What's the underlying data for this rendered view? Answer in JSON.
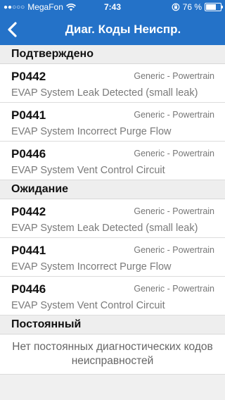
{
  "status_bar": {
    "signal_dots": "●●○○○",
    "carrier": "MegaFon",
    "wifi_icon": "wifi-icon",
    "time": "7:43",
    "battery_percent_text": "76 %",
    "battery_level": 0.76
  },
  "nav": {
    "back_icon": "chevron-left-icon",
    "title": "Диаг. Коды Неиспр."
  },
  "sections": [
    {
      "title": "Подтверждено",
      "items": [
        {
          "code": "P0442",
          "category": "Generic - Powertrain",
          "description": "EVAP System Leak Detected (small leak)"
        },
        {
          "code": "P0441",
          "category": "Generic - Powertrain",
          "description": "EVAP System Incorrect Purge Flow"
        },
        {
          "code": "P0446",
          "category": "Generic - Powertrain",
          "description": "EVAP System Vent Control Circuit"
        }
      ]
    },
    {
      "title": "Ожидание",
      "items": [
        {
          "code": "P0442",
          "category": "Generic - Powertrain",
          "description": "EVAP System Leak Detected (small leak)"
        },
        {
          "code": "P0441",
          "category": "Generic - Powertrain",
          "description": "EVAP System Incorrect Purge Flow"
        },
        {
          "code": "P0446",
          "category": "Generic - Powertrain",
          "description": "EVAP System Vent Control Circuit"
        }
      ]
    },
    {
      "title": "Постоянный",
      "empty_text": "Нет постоянных диагностических кодов неисправностей"
    }
  ],
  "colors": {
    "bar": "#2472c8"
  }
}
